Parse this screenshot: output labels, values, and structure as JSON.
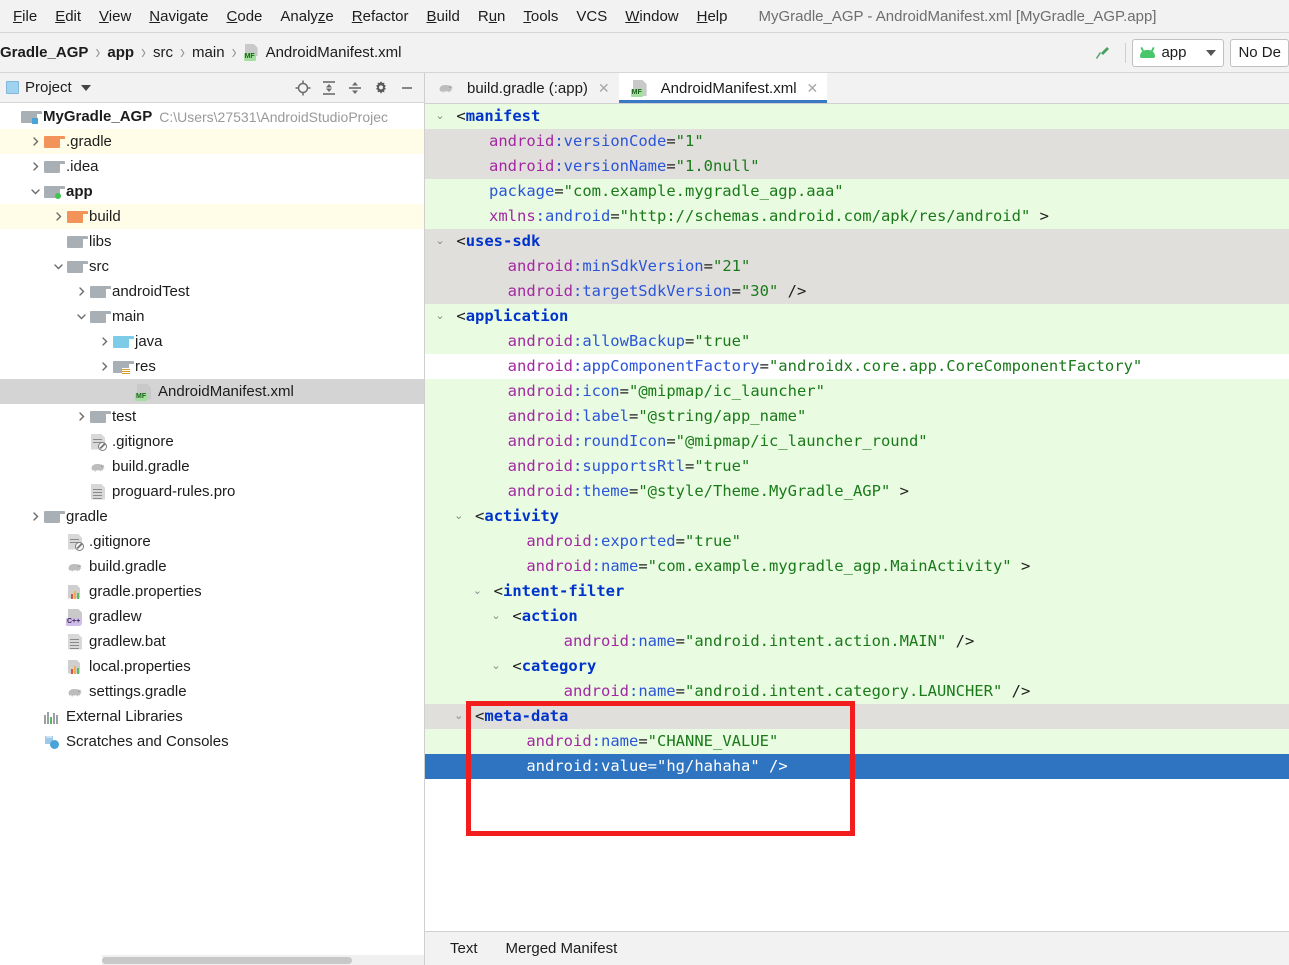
{
  "menu": {
    "items": [
      {
        "label": "File",
        "mnemonic": "F"
      },
      {
        "label": "Edit",
        "mnemonic": "E"
      },
      {
        "label": "View",
        "mnemonic": "V"
      },
      {
        "label": "Navigate",
        "mnemonic": "N"
      },
      {
        "label": "Code",
        "mnemonic": "C"
      },
      {
        "label": "Analyze",
        "mnemonic": "z"
      },
      {
        "label": "Refactor",
        "mnemonic": "R"
      },
      {
        "label": "Build",
        "mnemonic": "B"
      },
      {
        "label": "Run",
        "mnemonic": "u"
      },
      {
        "label": "Tools",
        "mnemonic": "T"
      },
      {
        "label": "VCS",
        "mnemonic": ""
      },
      {
        "label": "Window",
        "mnemonic": "W"
      },
      {
        "label": "Help",
        "mnemonic": "H"
      }
    ],
    "window_title": "MyGradle_AGP - AndroidManifest.xml [MyGradle_AGP.app]"
  },
  "navbar": {
    "breadcrumbs": [
      {
        "label": "Gradle_AGP",
        "bold": true,
        "icon": ""
      },
      {
        "label": "app",
        "bold": true,
        "icon": ""
      },
      {
        "label": "src",
        "bold": false,
        "icon": ""
      },
      {
        "label": "main",
        "bold": false,
        "icon": ""
      },
      {
        "label": "AndroidManifest.xml",
        "bold": false,
        "icon": "manifest-file-icon"
      }
    ],
    "separator": "›",
    "hammer_icon": "build-hammer-icon",
    "module_selector": "app",
    "device_selector": "No De"
  },
  "project_panel": {
    "title": "Project",
    "tools": [
      {
        "name": "locate-icon"
      },
      {
        "name": "expand-all-icon"
      },
      {
        "name": "collapse-all-icon"
      },
      {
        "name": "settings-gear-icon"
      },
      {
        "name": "minimize-icon"
      }
    ],
    "tree": [
      {
        "label": "MyGradle_AGP",
        "path": "C:\\Users\\27531\\AndroidStudioProjec",
        "indent": 0,
        "arrow": "",
        "icon": "project-folder-icon",
        "bold": true,
        "highlight": ""
      },
      {
        "label": ".gradle",
        "path": "",
        "indent": 1,
        "arrow": "collapsed",
        "icon": "folder-orange-icon",
        "bold": false,
        "highlight": "yellow"
      },
      {
        "label": ".idea",
        "path": "",
        "indent": 1,
        "arrow": "collapsed",
        "icon": "folder-grey-icon",
        "bold": false,
        "highlight": ""
      },
      {
        "label": "app",
        "path": "",
        "indent": 1,
        "arrow": "expanded",
        "icon": "module-folder-icon",
        "bold": true,
        "highlight": ""
      },
      {
        "label": "build",
        "path": "",
        "indent": 2,
        "arrow": "collapsed",
        "icon": "folder-orange-icon",
        "bold": false,
        "highlight": "yellow"
      },
      {
        "label": "libs",
        "path": "",
        "indent": 2,
        "arrow": "",
        "icon": "folder-grey-icon",
        "bold": false,
        "highlight": ""
      },
      {
        "label": "src",
        "path": "",
        "indent": 2,
        "arrow": "expanded",
        "icon": "folder-grey-icon",
        "bold": false,
        "highlight": ""
      },
      {
        "label": "androidTest",
        "path": "",
        "indent": 3,
        "arrow": "collapsed",
        "icon": "folder-grey-icon",
        "bold": false,
        "highlight": ""
      },
      {
        "label": "main",
        "path": "",
        "indent": 3,
        "arrow": "expanded",
        "icon": "folder-grey-icon",
        "bold": false,
        "highlight": ""
      },
      {
        "label": "java",
        "path": "",
        "indent": 4,
        "arrow": "collapsed",
        "icon": "folder-blue-icon",
        "bold": false,
        "highlight": ""
      },
      {
        "label": "res",
        "path": "",
        "indent": 4,
        "arrow": "collapsed",
        "icon": "folder-res-icon",
        "bold": false,
        "highlight": ""
      },
      {
        "label": "AndroidManifest.xml",
        "path": "",
        "indent": 5,
        "arrow": "",
        "icon": "manifest-file-icon",
        "bold": false,
        "highlight": "selected"
      },
      {
        "label": "test",
        "path": "",
        "indent": 3,
        "arrow": "collapsed",
        "icon": "folder-grey-icon",
        "bold": false,
        "highlight": ""
      },
      {
        "label": ".gitignore",
        "path": "",
        "indent": 3,
        "arrow": "",
        "icon": "gitignore-file-icon",
        "bold": false,
        "highlight": ""
      },
      {
        "label": "build.gradle",
        "path": "",
        "indent": 3,
        "arrow": "",
        "icon": "gradle-elephant-icon",
        "bold": false,
        "highlight": ""
      },
      {
        "label": "proguard-rules.pro",
        "path": "",
        "indent": 3,
        "arrow": "",
        "icon": "text-file-icon",
        "bold": false,
        "highlight": ""
      },
      {
        "label": "gradle",
        "path": "",
        "indent": 1,
        "arrow": "collapsed",
        "icon": "folder-grey-icon",
        "bold": false,
        "highlight": ""
      },
      {
        "label": ".gitignore",
        "path": "",
        "indent": 2,
        "arrow": "",
        "icon": "gitignore-file-icon",
        "bold": false,
        "highlight": ""
      },
      {
        "label": "build.gradle",
        "path": "",
        "indent": 2,
        "arrow": "",
        "icon": "gradle-elephant-icon",
        "bold": false,
        "highlight": ""
      },
      {
        "label": "gradle.properties",
        "path": "",
        "indent": 2,
        "arrow": "",
        "icon": "properties-file-icon",
        "bold": false,
        "highlight": ""
      },
      {
        "label": "gradlew",
        "path": "",
        "indent": 2,
        "arrow": "",
        "icon": "cpp-file-icon",
        "bold": false,
        "highlight": ""
      },
      {
        "label": "gradlew.bat",
        "path": "",
        "indent": 2,
        "arrow": "",
        "icon": "text-file-icon",
        "bold": false,
        "highlight": ""
      },
      {
        "label": "local.properties",
        "path": "",
        "indent": 2,
        "arrow": "",
        "icon": "properties-file-icon",
        "bold": false,
        "highlight": ""
      },
      {
        "label": "settings.gradle",
        "path": "",
        "indent": 2,
        "arrow": "",
        "icon": "gradle-elephant-icon",
        "bold": false,
        "highlight": ""
      },
      {
        "label": "External Libraries",
        "path": "",
        "indent": 1,
        "arrow": "",
        "icon": "external-libraries-icon",
        "bold": false,
        "highlight": ""
      },
      {
        "label": "Scratches and Consoles",
        "path": "",
        "indent": 1,
        "arrow": "",
        "icon": "scratches-icon",
        "bold": false,
        "highlight": ""
      }
    ]
  },
  "editor": {
    "tabs": [
      {
        "label": "build.gradle (:app)",
        "icon": "gradle-elephant-icon",
        "active": false,
        "closable": true
      },
      {
        "label": "AndroidManifest.xml",
        "icon": "manifest-file-icon",
        "active": true,
        "closable": true
      }
    ],
    "bottom_tabs": [
      "Text",
      "Merged Manifest"
    ],
    "colors": {
      "tag": "#0033cc",
      "attribute_ns": "#a327a3",
      "attribute_name": "#2b55d8",
      "string": "#1a7a1a",
      "line_added": "#e9fbe1",
      "line_modified": "#e1dfdb",
      "selection": "#2f74c0",
      "highlight_box": "#f21d1d",
      "tab_underline": "#3b78c4"
    },
    "lines": [
      {
        "bg": "green",
        "fold": "expanded",
        "indent": 0,
        "tokens": [
          {
            "t": "pun",
            "v": "<"
          },
          {
            "t": "tag",
            "v": "manifest"
          }
        ]
      },
      {
        "bg": "grey",
        "fold": "",
        "indent": 2,
        "tokens": [
          {
            "t": "attr",
            "v": "android"
          },
          {
            "t": "attr2",
            "v": ":versionCode"
          },
          {
            "t": "eq",
            "v": "="
          },
          {
            "t": "str",
            "v": "\"1\""
          }
        ]
      },
      {
        "bg": "grey",
        "fold": "",
        "indent": 2,
        "tokens": [
          {
            "t": "attr",
            "v": "android"
          },
          {
            "t": "attr2",
            "v": ":versionName"
          },
          {
            "t": "eq",
            "v": "="
          },
          {
            "t": "str",
            "v": "\"1.0null\""
          }
        ]
      },
      {
        "bg": "green",
        "fold": "",
        "indent": 2,
        "tokens": [
          {
            "t": "attr2",
            "v": "package"
          },
          {
            "t": "eq",
            "v": "="
          },
          {
            "t": "str",
            "v": "\"com.example.mygradle_agp.aaa\""
          }
        ]
      },
      {
        "bg": "green",
        "fold": "",
        "indent": 2,
        "tokens": [
          {
            "t": "attr",
            "v": "xmlns"
          },
          {
            "t": "attr2",
            "v": ":android"
          },
          {
            "t": "eq",
            "v": "="
          },
          {
            "t": "str",
            "v": "\"http://schemas.android.com/apk/res/android\""
          },
          {
            "t": "pun",
            "v": " >"
          }
        ]
      },
      {
        "bg": "grey",
        "fold": "expanded",
        "indent": 1,
        "tokens": [
          {
            "t": "pun",
            "v": "<"
          },
          {
            "t": "tag",
            "v": "uses-sdk"
          }
        ]
      },
      {
        "bg": "grey",
        "fold": "",
        "indent": 3,
        "tokens": [
          {
            "t": "attr",
            "v": "android"
          },
          {
            "t": "attr2",
            "v": ":minSdkVersion"
          },
          {
            "t": "eq",
            "v": "="
          },
          {
            "t": "str",
            "v": "\"21\""
          }
        ]
      },
      {
        "bg": "grey",
        "fold": "",
        "indent": 3,
        "tokens": [
          {
            "t": "attr",
            "v": "android"
          },
          {
            "t": "attr2",
            "v": ":targetSdkVersion"
          },
          {
            "t": "eq",
            "v": "="
          },
          {
            "t": "str",
            "v": "\"30\""
          },
          {
            "t": "pun",
            "v": " />"
          }
        ]
      },
      {
        "bg": "green",
        "fold": "expanded",
        "indent": 1,
        "tokens": [
          {
            "t": "pun",
            "v": "<"
          },
          {
            "t": "tag",
            "v": "application"
          }
        ]
      },
      {
        "bg": "green",
        "fold": "",
        "indent": 3,
        "tokens": [
          {
            "t": "attr",
            "v": "android"
          },
          {
            "t": "attr2",
            "v": ":allowBackup"
          },
          {
            "t": "eq",
            "v": "="
          },
          {
            "t": "str",
            "v": "\"true\""
          }
        ]
      },
      {
        "bg": "white",
        "fold": "",
        "indent": 3,
        "tokens": [
          {
            "t": "attr",
            "v": "android"
          },
          {
            "t": "attr2",
            "v": ":appComponentFactory"
          },
          {
            "t": "eq",
            "v": "="
          },
          {
            "t": "str",
            "v": "\"androidx.core.app.CoreComponentFactory\""
          }
        ]
      },
      {
        "bg": "green",
        "fold": "",
        "indent": 3,
        "tokens": [
          {
            "t": "attr",
            "v": "android"
          },
          {
            "t": "attr2",
            "v": ":icon"
          },
          {
            "t": "eq",
            "v": "="
          },
          {
            "t": "str",
            "v": "\"@mipmap/ic_launcher\""
          }
        ]
      },
      {
        "bg": "green",
        "fold": "",
        "indent": 3,
        "tokens": [
          {
            "t": "attr",
            "v": "android"
          },
          {
            "t": "attr2",
            "v": ":label"
          },
          {
            "t": "eq",
            "v": "="
          },
          {
            "t": "str",
            "v": "\"@string/app_name\""
          }
        ]
      },
      {
        "bg": "green",
        "fold": "",
        "indent": 3,
        "tokens": [
          {
            "t": "attr",
            "v": "android"
          },
          {
            "t": "attr2",
            "v": ":roundIcon"
          },
          {
            "t": "eq",
            "v": "="
          },
          {
            "t": "str",
            "v": "\"@mipmap/ic_launcher_round\""
          }
        ]
      },
      {
        "bg": "green",
        "fold": "",
        "indent": 3,
        "tokens": [
          {
            "t": "attr",
            "v": "android"
          },
          {
            "t": "attr2",
            "v": ":supportsRtl"
          },
          {
            "t": "eq",
            "v": "="
          },
          {
            "t": "str",
            "v": "\"true\""
          }
        ]
      },
      {
        "bg": "green",
        "fold": "",
        "indent": 3,
        "tokens": [
          {
            "t": "attr",
            "v": "android"
          },
          {
            "t": "attr2",
            "v": ":theme"
          },
          {
            "t": "eq",
            "v": "="
          },
          {
            "t": "str",
            "v": "\"@style/Theme.MyGradle_AGP\""
          },
          {
            "t": "pun",
            "v": " >"
          }
        ]
      },
      {
        "bg": "green",
        "fold": "expanded",
        "indent": 2,
        "tokens": [
          {
            "t": "pun",
            "v": "<"
          },
          {
            "t": "tag",
            "v": "activity"
          }
        ]
      },
      {
        "bg": "green",
        "fold": "",
        "indent": 4,
        "tokens": [
          {
            "t": "attr",
            "v": "android"
          },
          {
            "t": "attr2",
            "v": ":exported"
          },
          {
            "t": "eq",
            "v": "="
          },
          {
            "t": "str",
            "v": "\"true\""
          }
        ]
      },
      {
        "bg": "green",
        "fold": "",
        "indent": 4,
        "tokens": [
          {
            "t": "attr",
            "v": "android"
          },
          {
            "t": "attr2",
            "v": ":name"
          },
          {
            "t": "eq",
            "v": "="
          },
          {
            "t": "str",
            "v": "\"com.example.mygradle_agp.MainActivity\""
          },
          {
            "t": "pun",
            "v": " >"
          }
        ]
      },
      {
        "bg": "green",
        "fold": "expanded",
        "indent": 3,
        "tokens": [
          {
            "t": "pun",
            "v": "<"
          },
          {
            "t": "tag",
            "v": "intent-filter"
          }
        ]
      },
      {
        "bg": "green",
        "fold": "expanded",
        "indent": 4,
        "tokens": [
          {
            "t": "pun",
            "v": "<"
          },
          {
            "t": "tag",
            "v": "action"
          }
        ]
      },
      {
        "bg": "green",
        "fold": "",
        "indent": 6,
        "tokens": [
          {
            "t": "attr",
            "v": "android"
          },
          {
            "t": "attr2",
            "v": ":name"
          },
          {
            "t": "eq",
            "v": "="
          },
          {
            "t": "str",
            "v": "\"android.intent.action.MAIN\""
          },
          {
            "t": "pun",
            "v": " />"
          }
        ]
      },
      {
        "bg": "green",
        "fold": "expanded",
        "indent": 4,
        "tokens": [
          {
            "t": "pun",
            "v": "<"
          },
          {
            "t": "tag",
            "v": "category"
          }
        ]
      },
      {
        "bg": "green",
        "fold": "",
        "indent": 6,
        "tokens": [
          {
            "t": "attr",
            "v": "android"
          },
          {
            "t": "attr2",
            "v": ":name"
          },
          {
            "t": "eq",
            "v": "="
          },
          {
            "t": "str",
            "v": "\"android.intent.category.LAUNCHER\""
          },
          {
            "t": "pun",
            "v": " />"
          }
        ]
      },
      {
        "bg": "grey",
        "fold": "expanded",
        "indent": 2,
        "tokens": [
          {
            "t": "pun",
            "v": "<"
          },
          {
            "t": "tag",
            "v": "meta-data"
          }
        ]
      },
      {
        "bg": "green",
        "fold": "",
        "indent": 4,
        "tokens": [
          {
            "t": "attr",
            "v": "android"
          },
          {
            "t": "attr2",
            "v": ":name"
          },
          {
            "t": "eq",
            "v": "="
          },
          {
            "t": "str",
            "v": "\"CHANNE_VALUE\""
          }
        ]
      },
      {
        "bg": "sel",
        "fold": "",
        "indent": 4,
        "tokens": [
          {
            "t": "attr",
            "v": "android"
          },
          {
            "t": "attr2",
            "v": ":value"
          },
          {
            "t": "eq",
            "v": "="
          },
          {
            "t": "str",
            "v": "\"hg/hahaha\""
          },
          {
            "t": "pun",
            "v": " />"
          }
        ]
      }
    ]
  }
}
